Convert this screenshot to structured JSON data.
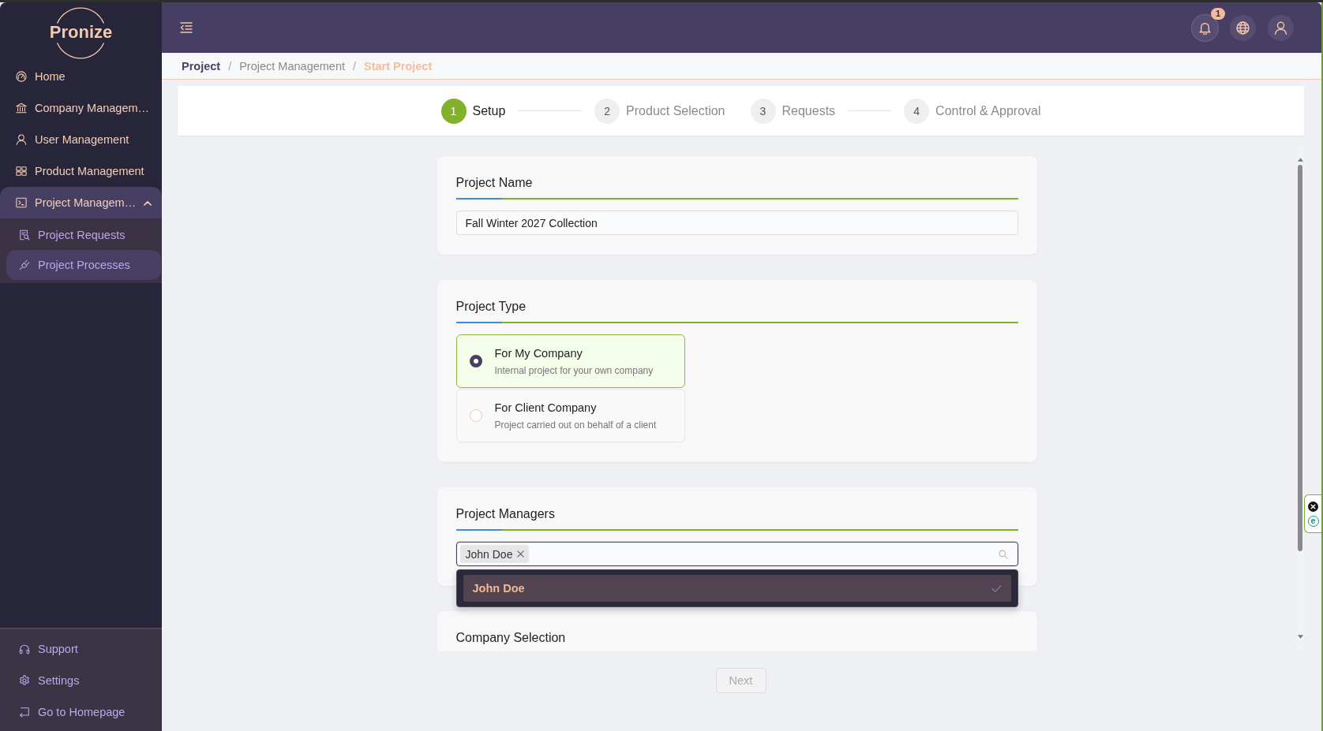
{
  "sidebar": {
    "logo": "Pronize",
    "items": [
      {
        "label": "Home",
        "selected": false
      },
      {
        "label": "Company Managem…",
        "selected": false
      },
      {
        "label": "User Management",
        "selected": false
      },
      {
        "label": "Product Management",
        "selected": false
      },
      {
        "label": "Project Managem…",
        "selected": true,
        "expanded": true,
        "children": [
          {
            "label": "Project Requests",
            "selected": false
          },
          {
            "label": "Project Processes",
            "selected": true
          }
        ]
      }
    ],
    "footer_items": [
      {
        "label": "Support"
      },
      {
        "label": "Settings"
      },
      {
        "label": "Go to Homepage"
      }
    ]
  },
  "header": {
    "notification_count": "1"
  },
  "breadcrumb": {
    "separator": "/",
    "items": [
      {
        "label": "Project",
        "kind": "root"
      },
      {
        "label": "Project Management",
        "kind": "link"
      },
      {
        "label": "Start Project",
        "kind": "current"
      }
    ]
  },
  "stepper": [
    {
      "number": "1",
      "label": "Setup",
      "selected": true
    },
    {
      "number": "2",
      "label": "Product Selection",
      "selected": false
    },
    {
      "number": "3",
      "label": "Requests",
      "selected": false
    },
    {
      "number": "4",
      "label": "Control & Approval",
      "selected": false
    }
  ],
  "sections": [
    {
      "kind": "text",
      "title": "Project Name",
      "value": "Fall Winter 2027 Collection"
    },
    {
      "kind": "radio",
      "title": "Project Type",
      "options": [
        {
          "label": "For My Company",
          "description": "Internal project for your own company",
          "selected": true
        },
        {
          "label": "For Client Company",
          "description": "Project carried out on behalf of a client",
          "selected": false
        }
      ]
    },
    {
      "kind": "multiselect",
      "title": "Project Managers",
      "focused": true,
      "chips": [
        "John Doe"
      ],
      "dropdown": [
        {
          "label": "John Doe",
          "selected": true
        }
      ]
    },
    {
      "kind": "heading",
      "title": "Company Selection"
    }
  ],
  "next_button": {
    "label": "Next",
    "disabled": true
  },
  "extension_widget": {
    "label": "e"
  }
}
